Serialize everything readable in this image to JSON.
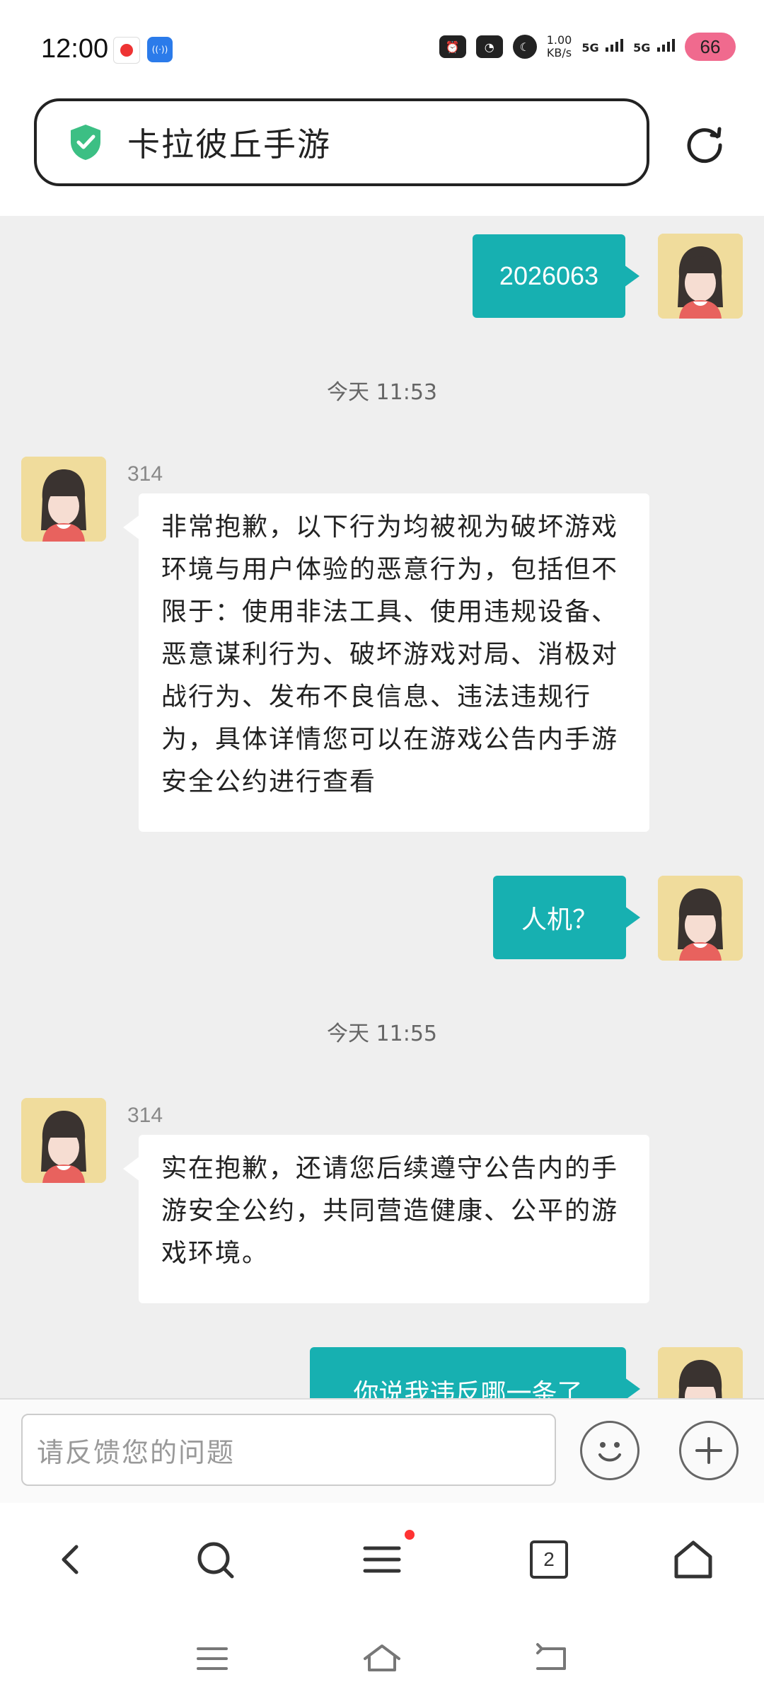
{
  "status_bar": {
    "time": "12:00",
    "net_speed_value": "1.00",
    "net_speed_unit": "KB/s",
    "sim1": "5G",
    "sim2": "5G",
    "battery": "66"
  },
  "header": {
    "title": "卡拉彼丘手游"
  },
  "messages": {
    "m1_text": "2026063",
    "ts1": "今天 11:53",
    "m2_sender": "314",
    "m2_text": "非常抱歉，以下行为均被视为破坏游戏环境与用户体验的恶意行为，包括但不限于：使用非法工具、使用违规设备、恶意谋利行为、破坏游戏对局、消极对战行为、发布不良信息、违法违规行为，具体详情您可以在游戏公告内手游安全公约进行查看",
    "m3_text": "人机？",
    "ts2": "今天 11:55",
    "m4_sender": "314",
    "m4_text": "实在抱歉，还请您后续遵守公告内的手游安全公约，共同营造健康、公平的游戏环境。",
    "m5_text": "你说我违反哪一条了"
  },
  "input": {
    "placeholder": "请反馈您的问题"
  },
  "browser_nav": {
    "tabs_count": "2"
  },
  "colors": {
    "accent": "#17b0b1",
    "chat_bg": "#efefef",
    "shield": "#3cbf84",
    "badge": "#f33333"
  }
}
